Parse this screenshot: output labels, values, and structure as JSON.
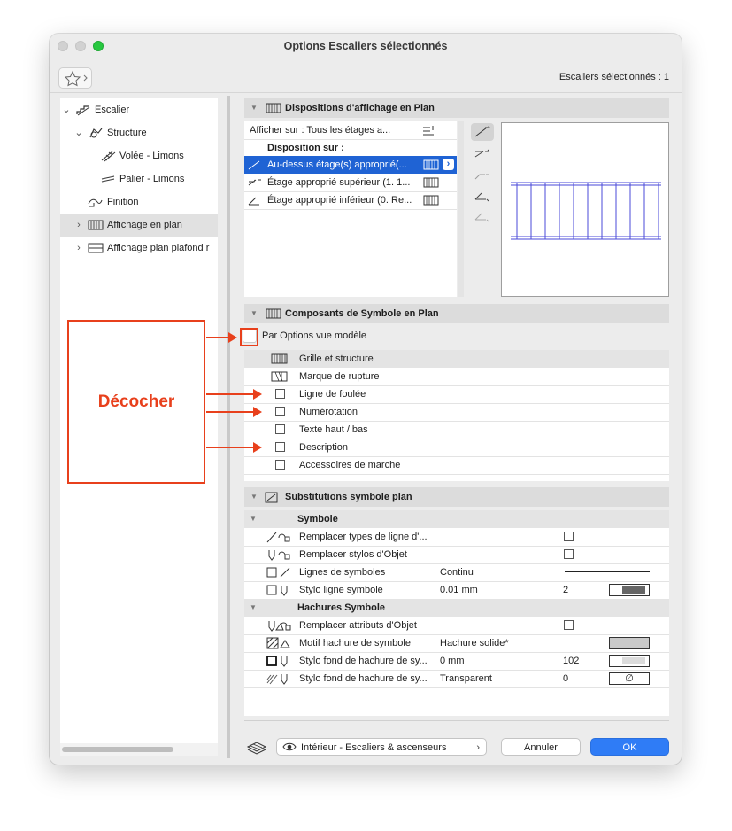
{
  "window": {
    "title": "Options Escaliers sélectionnés",
    "selection_info": "Escaliers sélectionnés : 1"
  },
  "sidebar": {
    "items": [
      {
        "label": "Escalier"
      },
      {
        "label": "Structure"
      },
      {
        "label": "Volée - Limons"
      },
      {
        "label": "Palier - Limons"
      },
      {
        "label": "Finition"
      },
      {
        "label": "Affichage en plan"
      },
      {
        "label": "Affichage plan plafond r"
      }
    ]
  },
  "dispositions": {
    "title": "Dispositions d'affichage en Plan",
    "afficher_sur": "Afficher sur : Tous les étages a...",
    "disposition_header": "Disposition sur :",
    "items": [
      {
        "label": "Au-dessus étage(s) approprié(..."
      },
      {
        "label": "Étage approprié supérieur (1. 1..."
      },
      {
        "label": "Étage approprié inférieur (0. Re..."
      }
    ]
  },
  "composants": {
    "title": "Composants de Symbole en Plan",
    "par_options": "Par Options vue modèle",
    "items": [
      {
        "label": "Grille et structure"
      },
      {
        "label": "Marque de rupture"
      },
      {
        "label": "Ligne de foulée"
      },
      {
        "label": "Numérotation"
      },
      {
        "label": "Texte haut / bas"
      },
      {
        "label": "Description"
      },
      {
        "label": "Accessoires de marche"
      }
    ]
  },
  "substitutions": {
    "title": "Substitutions symbole plan",
    "groups": {
      "symbole": "Symbole",
      "hachures": "Hachures Symbole"
    },
    "rows": [
      {
        "label": "Remplacer types de ligne d'...",
        "value": "",
        "num": ""
      },
      {
        "label": "Remplacer stylos d'Objet",
        "value": "",
        "num": ""
      },
      {
        "label": "Lignes de symboles",
        "value": "Continu",
        "num": ""
      },
      {
        "label": "Stylo ligne symbole",
        "value": "0.01 mm",
        "num": "2"
      },
      {
        "label": "Remplacer attributs d'Objet",
        "value": "",
        "num": ""
      },
      {
        "label": "Motif hachure de symbole",
        "value": "Hachure solide*",
        "num": ""
      },
      {
        "label": "Stylo fond de hachure de sy...",
        "value": "0 mm",
        "num": "102"
      },
      {
        "label": "Stylo fond de hachure de sy...",
        "value": "Transparent",
        "num": "0"
      }
    ],
    "empty_symbol": "∅"
  },
  "footer": {
    "view_label": "Intérieur - Escaliers & ascenseurs",
    "cancel": "Annuler",
    "ok": "OK"
  },
  "annotation": {
    "label": "Décocher",
    "color": "#e8401c"
  },
  "colors": {
    "accent": "#2f6fd6",
    "selection": "#1f63d4"
  }
}
